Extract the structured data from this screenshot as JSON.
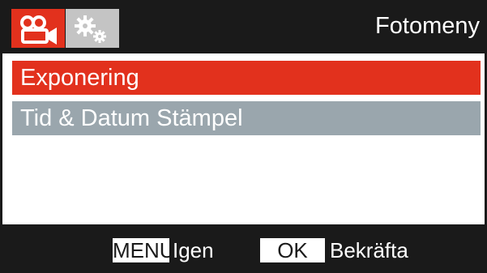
{
  "header": {
    "title": "Fotomeny",
    "tabs": [
      {
        "icon": "video-camera-icon",
        "active": true
      },
      {
        "icon": "gears-icon",
        "active": false
      }
    ]
  },
  "menu": {
    "items": [
      {
        "label": "Exponering",
        "selected": true
      },
      {
        "label": "Tid & Datum Stämpel",
        "selected": false
      }
    ]
  },
  "footer": {
    "menu_key": "MENU",
    "menu_hint": "Igen",
    "ok_key": "OK",
    "ok_hint": "Bekräfta"
  },
  "colors": {
    "background": "#1a1a1a",
    "accent": "#e2311d",
    "item_inactive": "#9aa6ad",
    "tab_inactive": "#c4c4c4"
  }
}
